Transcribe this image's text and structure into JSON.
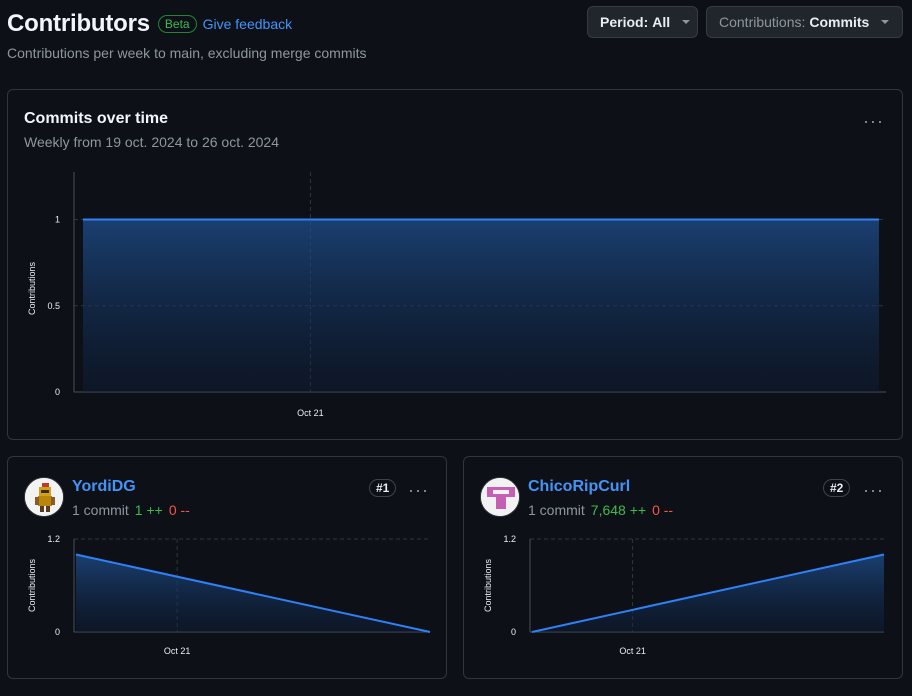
{
  "header": {
    "title": "Contributors",
    "beta": "Beta",
    "feedback": "Give feedback",
    "subtitle": "Contributions per week to main, excluding merge commits"
  },
  "controls": {
    "period_label": "Period:",
    "period_value": "All",
    "contrib_label": "Contributions:",
    "contrib_value": "Commits"
  },
  "main_chart": {
    "title": "Commits over time",
    "subtitle": "Weekly from 19 oct. 2024 to 26 oct. 2024",
    "more_icon": "kebab-horizontal-icon"
  },
  "contributors": [
    {
      "name": "YordiDG",
      "commits": "1 commit",
      "additions": "1 ++",
      "deletions": "0 --",
      "rank": "#1",
      "avatar_icon": "pixel-knight-avatar-icon"
    },
    {
      "name": "ChicoRipCurl",
      "commits": "1 commit",
      "additions": "7,648 ++",
      "deletions": "0 --",
      "rank": "#2",
      "avatar_icon": "identicon-avatar-icon"
    }
  ],
  "chart_data": [
    {
      "type": "area",
      "x": [
        "2024-10-19",
        "2024-10-26"
      ],
      "series": [
        {
          "values": [
            1,
            1
          ]
        }
      ],
      "xticks": [
        "Oct 21"
      ],
      "yticks": [
        0,
        0.5,
        1
      ],
      "ylabel": "Contributions",
      "ylim": [
        0,
        1.2
      ],
      "grid": true,
      "color": "#2f81f7"
    },
    {
      "type": "area",
      "x": [
        "2024-10-19",
        "2024-10-26"
      ],
      "series": [
        {
          "values": [
            1,
            0
          ]
        }
      ],
      "xticks": [
        "Oct 21"
      ],
      "yticks": [
        0,
        1.2
      ],
      "ylabel": "Contributions",
      "ylim": [
        0,
        1.2
      ],
      "grid": true,
      "color": "#2f81f7"
    },
    {
      "type": "area",
      "x": [
        "2024-10-19",
        "2024-10-26"
      ],
      "series": [
        {
          "values": [
            0,
            1
          ]
        }
      ],
      "xticks": [
        "Oct 21"
      ],
      "yticks": [
        0,
        1.2
      ],
      "ylabel": "Contributions",
      "ylim": [
        0,
        1.2
      ],
      "grid": true,
      "color": "#2f81f7"
    }
  ]
}
